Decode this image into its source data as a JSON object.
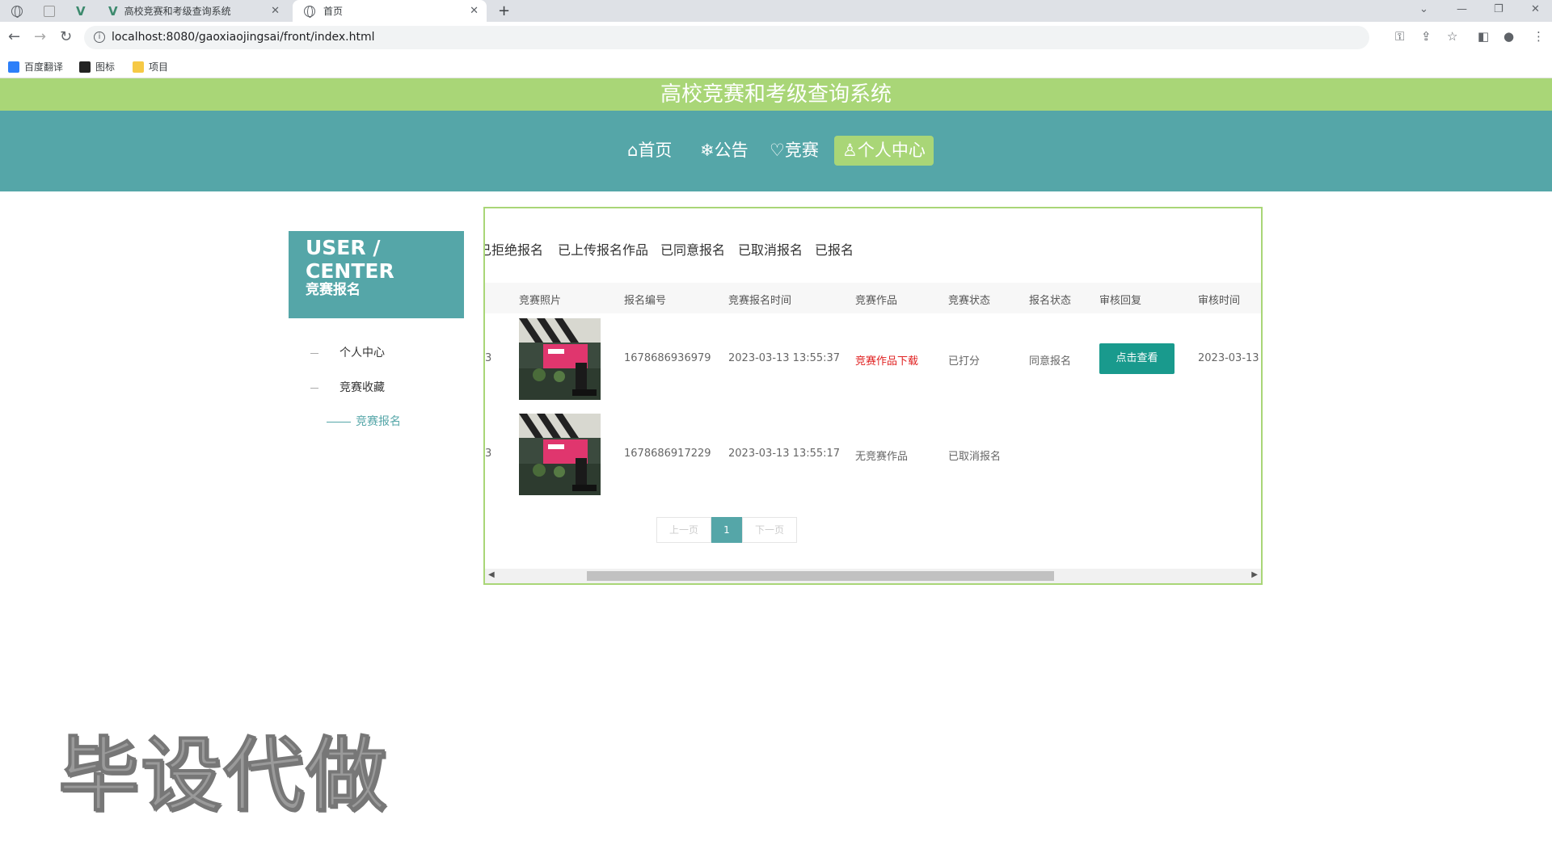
{
  "browser": {
    "tabs": [
      {
        "title": "高校竞赛和考级查询系统"
      },
      {
        "title": "首页"
      }
    ],
    "url": "localhost:8080/gaoxiaojingsai/front/index.html",
    "bookmarks": [
      "百度翻译",
      "图标",
      "项目"
    ]
  },
  "site": {
    "title": "高校竞赛和考级查询系统"
  },
  "nav": [
    {
      "label": "⌂首页"
    },
    {
      "label": "❄公告"
    },
    {
      "label": "♡竞赛"
    },
    {
      "label": "♙个人中心"
    }
  ],
  "user_center": {
    "title": "USER / CENTER",
    "subtitle": "竞赛报名"
  },
  "menu": [
    {
      "label": "个人中心"
    },
    {
      "label": "竞赛收藏"
    },
    {
      "label": "竞赛报名"
    }
  ],
  "filters": [
    "已拒绝报名",
    "已上传报名作品",
    "已同意报名",
    "已取消报名",
    "已报名"
  ],
  "table": {
    "columns": [
      "竞赛照片",
      "报名编号",
      "竞赛报名时间",
      "竞赛作品",
      "竞赛状态",
      "报名状态",
      "审核回复",
      "审核时间"
    ],
    "rows": [
      {
        "prefix": "3",
        "number": "1678686936979",
        "time": "2023-03-13 13:55:37",
        "work": "竞赛作品下载",
        "status": "已打分",
        "reg_status": "同意报名",
        "reply": "点击查看",
        "review_time": "2023-03-13 1"
      },
      {
        "prefix": "3",
        "number": "1678686917229",
        "time": "2023-03-13 13:55:17",
        "work": "无竞赛作品",
        "status": "已取消报名",
        "reg_status": "",
        "reply": "",
        "review_time": ""
      }
    ]
  },
  "pagination": {
    "prev": "上一页",
    "current": "1",
    "next": "下一页"
  },
  "watermark": "毕设代做",
  "colors": {
    "green": "#a9d677",
    "teal": "#55a6a8",
    "button": "#199a8d"
  }
}
